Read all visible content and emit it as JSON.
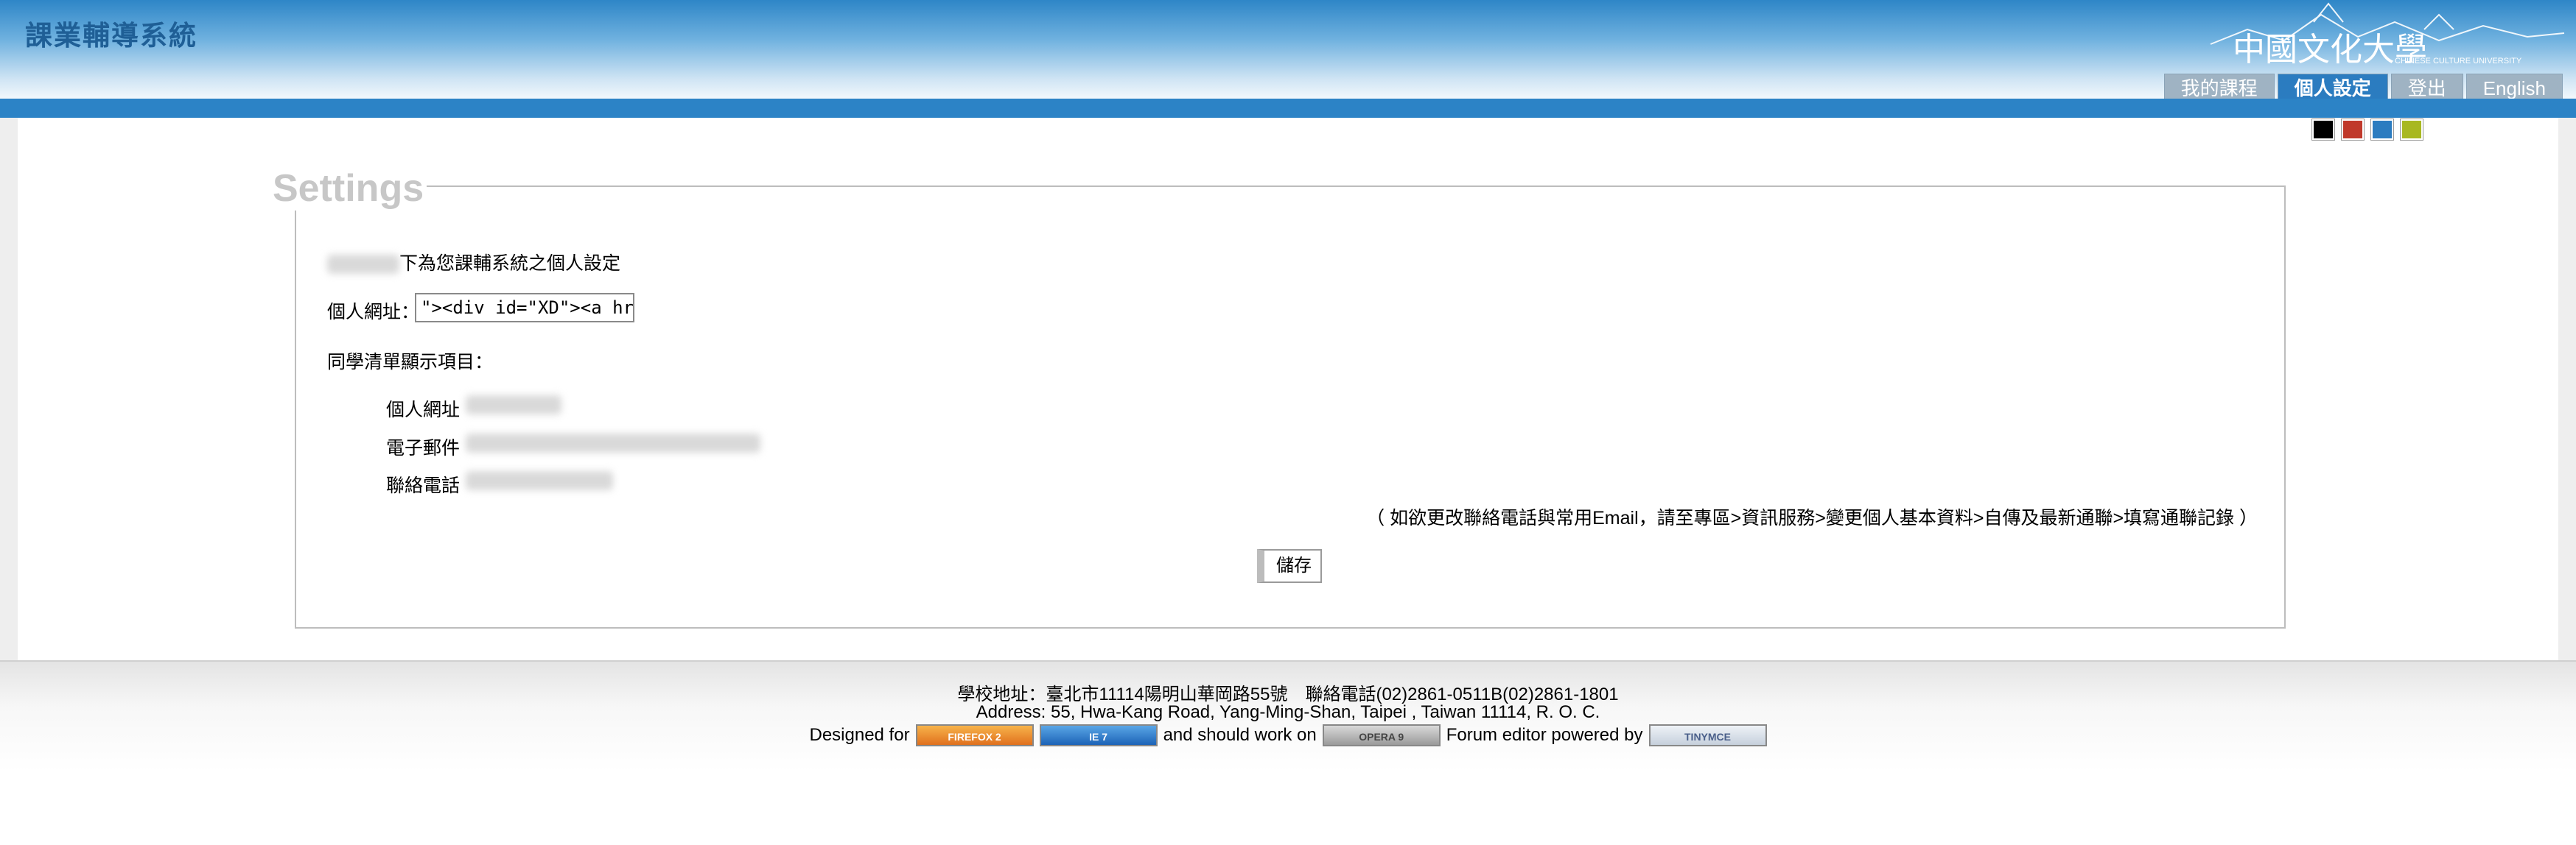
{
  "header": {
    "site_title": "課業輔導系統",
    "logo_text": "中國文化大學",
    "logo_subtext": "CHINESE CULTURE UNIVERSITY",
    "tabs": [
      {
        "label": "我的課程",
        "active": false
      },
      {
        "label": "個人設定",
        "active": true
      },
      {
        "label": "登出",
        "active": false
      },
      {
        "label": "English",
        "active": false
      }
    ]
  },
  "theme_swatches": [
    "#000000",
    "#c0392b",
    "#2b7cc0",
    "#a8b820"
  ],
  "settings": {
    "legend": "Settings",
    "intro_suffix": "下為您課輔系統之個人設定",
    "url_label": "個人網址：",
    "url_value": "\"><div id=\"XD\"><a hre",
    "classmate_list_label": "同學清單顯示項目：",
    "fields": [
      {
        "label": "個人網址"
      },
      {
        "label": "電子郵件"
      },
      {
        "label": "聯絡電話"
      }
    ],
    "note": "（ 如欲更改聯絡電話與常用Email，請至專區>資訊服務>變更個人基本資料>自傳及最新通聯>填寫通聯記錄 ）",
    "save_label": "儲存"
  },
  "footer": {
    "address_zh": "學校地址：臺北市11114陽明山華岡路55號　聯絡電話(02)2861-0511B(02)2861-1801",
    "address_en": "Address: 55, Hwa-Kang Road, Yang-Ming-Shan, Taipei , Taiwan 11114, R. O. C.",
    "designed_for": "Designed for",
    "should_work": "and should work on",
    "forum_editor": "Forum editor powered by",
    "badges": {
      "firefox": "FIREFOX 2",
      "ie": "IE 7",
      "opera": "OPERA 9",
      "tinymce": "TINYMCE"
    }
  }
}
